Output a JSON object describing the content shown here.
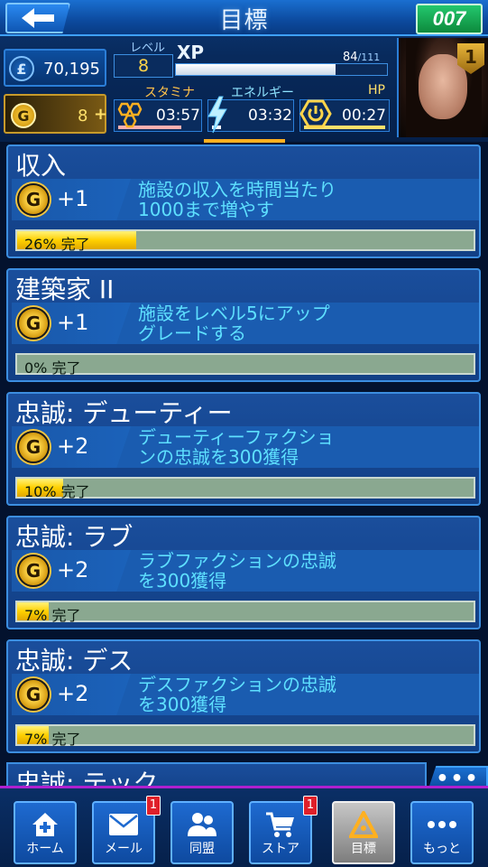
{
  "header": {
    "title": "目標",
    "logo_text": "007"
  },
  "player": {
    "money": "70,195",
    "gold": "8",
    "gold_plus": "+",
    "level_label": "レベル",
    "level": "8",
    "xp_label": "XP",
    "xp_current": "84",
    "xp_max": "/111",
    "xp_fraction": 0.757,
    "rank": "1"
  },
  "stats": {
    "stamina_label": "スタミナ",
    "stamina_time": "03:57",
    "energy_label": "エネルギー",
    "energy_time": "03:32",
    "hp_label": "HP",
    "hp_time": "00:27"
  },
  "goals": [
    {
      "title": "収入",
      "reward": "+1",
      "desc_line1": "施設の収入を時間当たり",
      "desc_line2": "1000まで増やす",
      "progress_text": "26% 完了",
      "progress": 0.26
    },
    {
      "title": "建築家 II",
      "reward": "+1",
      "desc_line1": "施設をレベル5にアップ",
      "desc_line2": "グレードする",
      "progress_text": "0% 完了",
      "progress": 0.0
    },
    {
      "title": "忠誠: デューティー",
      "reward": "+2",
      "desc_line1": "デューティーファクショ",
      "desc_line2": "ンの忠誠を300獲得",
      "progress_text": "10% 完了",
      "progress": 0.1
    },
    {
      "title": "忠誠: ラブ",
      "reward": "+2",
      "desc_line1": "ラブファクションの忠誠",
      "desc_line2": "を300獲得",
      "progress_text": "7% 完了",
      "progress": 0.07
    },
    {
      "title": "忠誠: デス",
      "reward": "+2",
      "desc_line1": "デスファクションの忠誠",
      "desc_line2": "を300獲得",
      "progress_text": "7% 完了",
      "progress": 0.07
    }
  ],
  "partial_goal_title": "忠誠: テック",
  "more_tab_label": "•••",
  "nav": {
    "home": "ホーム",
    "mail": "メール",
    "mail_badge": "1",
    "alliance": "同盟",
    "store": "ストア",
    "store_badge": "1",
    "goals": "目標",
    "more": "もっと"
  }
}
